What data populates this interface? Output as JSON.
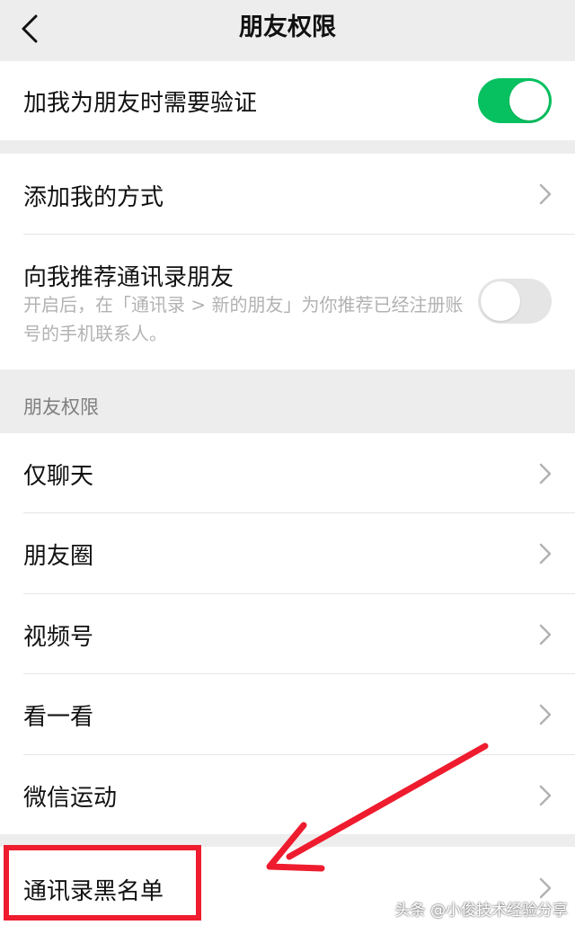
{
  "nav": {
    "title": "朋友权限"
  },
  "top_group": {
    "verify_label": "加我为朋友时需要验证",
    "verify_on": true
  },
  "add_group": {
    "methods_label": "添加我的方式",
    "recommend_label": "向我推荐通讯录朋友",
    "recommend_desc": "开启后，在「通讯录 > 新的朋友」为你推荐已经注册账号的手机联系人。",
    "recommend_on": false
  },
  "section_header": "朋友权限",
  "permissions": {
    "items": [
      "仅聊天",
      "朋友圈",
      "视频号",
      "看一看",
      "微信运动"
    ]
  },
  "blacklist": {
    "label": "通讯录黑名单"
  },
  "watermark": "头条 @小俊技术经验分享",
  "colors": {
    "accent": "#07c160",
    "annotation": "#ee1c2e"
  }
}
